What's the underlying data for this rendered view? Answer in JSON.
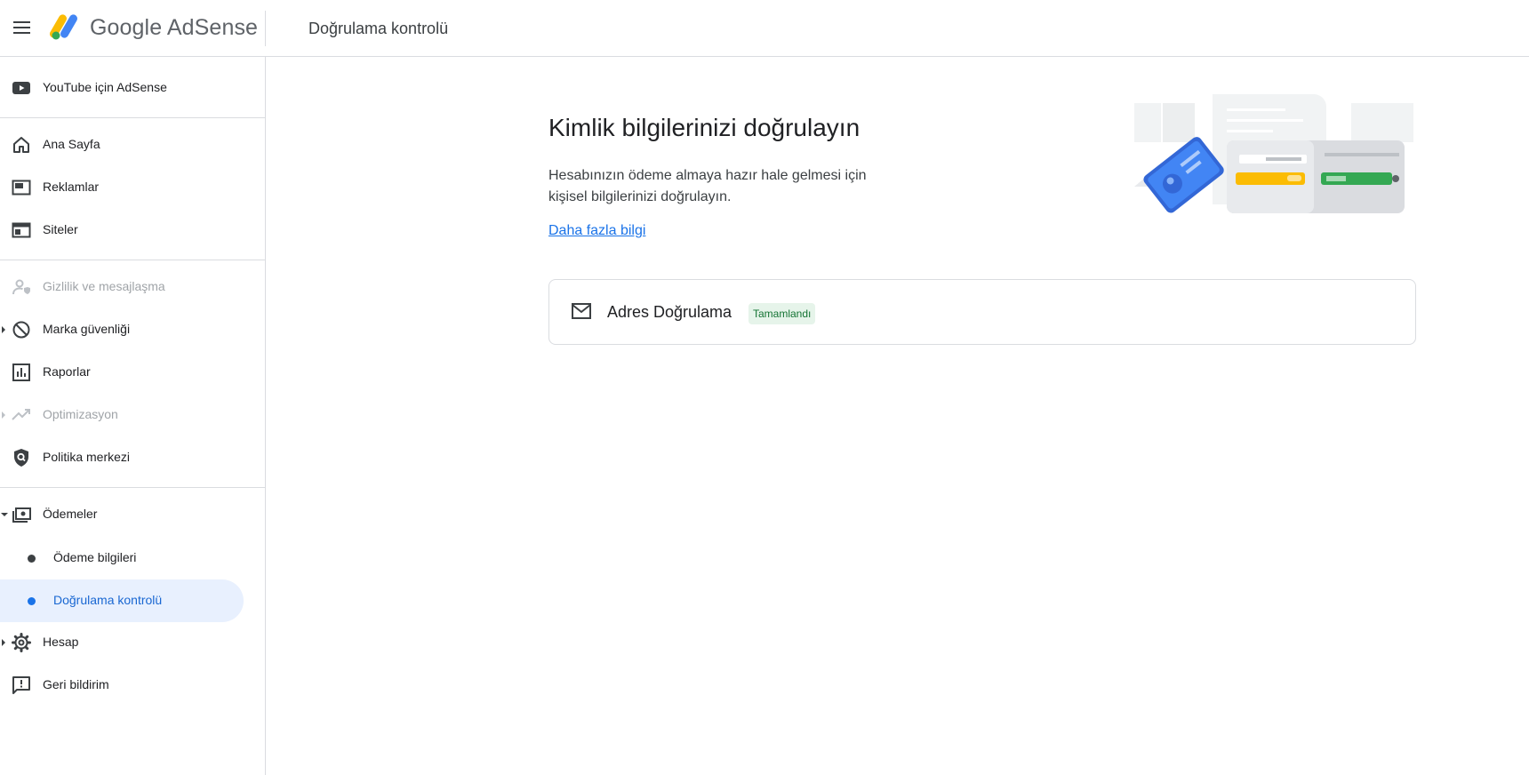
{
  "header": {
    "brand": "Google AdSense",
    "page_title": "Doğrulama kontrolü"
  },
  "sidebar": {
    "youtube": "YouTube için AdSense",
    "items": [
      {
        "label": "Ana Sayfa",
        "icon": "home-icon"
      },
      {
        "label": "Reklamlar",
        "icon": "ads-icon"
      },
      {
        "label": "Siteler",
        "icon": "sites-icon"
      },
      {
        "label": "Gizlilik ve mesajlaşma",
        "icon": "privacy-icon",
        "disabled": true
      },
      {
        "label": "Marka güvenliği",
        "icon": "block-icon",
        "expandable": true
      },
      {
        "label": "Raporlar",
        "icon": "reports-icon"
      },
      {
        "label": "Optimizasyon",
        "icon": "trending-icon",
        "disabled": true,
        "expandable": true
      },
      {
        "label": "Politika merkezi",
        "icon": "policy-shield-icon"
      },
      {
        "label": "Ödemeler",
        "icon": "payments-icon",
        "expanded": true
      },
      {
        "label": "Hesap",
        "icon": "gear-icon",
        "expandable": true
      },
      {
        "label": "Geri bildirim",
        "icon": "feedback-icon"
      }
    ],
    "payments_sub": [
      {
        "label": "Ödeme bilgileri"
      },
      {
        "label": "Doğrulama kontrolü",
        "active": true
      }
    ]
  },
  "main": {
    "title": "Kimlik bilgilerinizi doğrulayın",
    "description": "Hesabınızın ödeme almaya hazır hale gelmesi için kişisel bilgilerinizi doğrulayın.",
    "learn_more": "Daha fazla bilgi",
    "card": {
      "label": "Adres Doğrulama",
      "status": "Tamamlandı",
      "icon": "mail-icon"
    }
  },
  "colors": {
    "accent": "#1a73e8",
    "active_bg": "#e8f0fe",
    "success_text": "#137333",
    "success_bg": "#e6f4ea"
  }
}
